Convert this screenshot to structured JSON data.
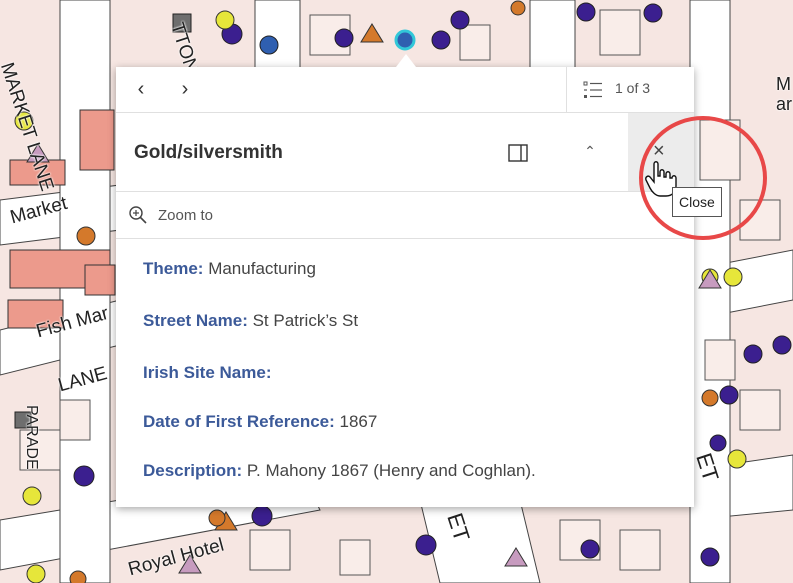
{
  "map": {
    "labels": {
      "market_lane": "MARKET LANE",
      "fitton": "TTON",
      "market": "Market",
      "fish_market": "Fish Mar",
      "lane": "LANE",
      "royal_hotel": "Royal Hotel",
      "et": "ET",
      "et2": "ET",
      "parade": "PARADE",
      "m": "M",
      "ar": "ar"
    },
    "colors": {
      "water": "#eaeaea",
      "block": "#f7e3e0",
      "building": "#e88e7e",
      "road": "#ffffff",
      "outline": "#333333",
      "purple": "#3a1d8e",
      "yellow": "#e8e82a",
      "orange": "#d97c2c",
      "grey": "#666666",
      "pink": "#c89dbe",
      "blue": "#2f5fb0"
    }
  },
  "popup": {
    "nav": {
      "prev_symbol": "‹",
      "next_symbol": "›"
    },
    "pager_text": "1 of 3",
    "title": "Gold/silversmith",
    "zoom_to": "Zoom to",
    "fields": [
      {
        "key": "Theme:",
        "value": " Manufacturing"
      },
      {
        "key": "Street Name:",
        "value": " St Patrick’s St"
      },
      {
        "key": "Irish Site Name:",
        "value": ""
      },
      {
        "key": "Date of First Reference:",
        "value": " 1867"
      },
      {
        "key": "Description:",
        "value": " P. Mahony 1867 (Henry and Coghlan)."
      }
    ],
    "icons": {
      "list": "list-icon",
      "dock": "dock-icon",
      "collapse": "chevron-up-icon",
      "close": "close-icon",
      "zoom": "zoom-in-icon"
    },
    "collapse_symbol": "⌃",
    "close_symbol": "×"
  },
  "tooltip": {
    "text": "Close"
  },
  "highlight_color": "#e84848"
}
